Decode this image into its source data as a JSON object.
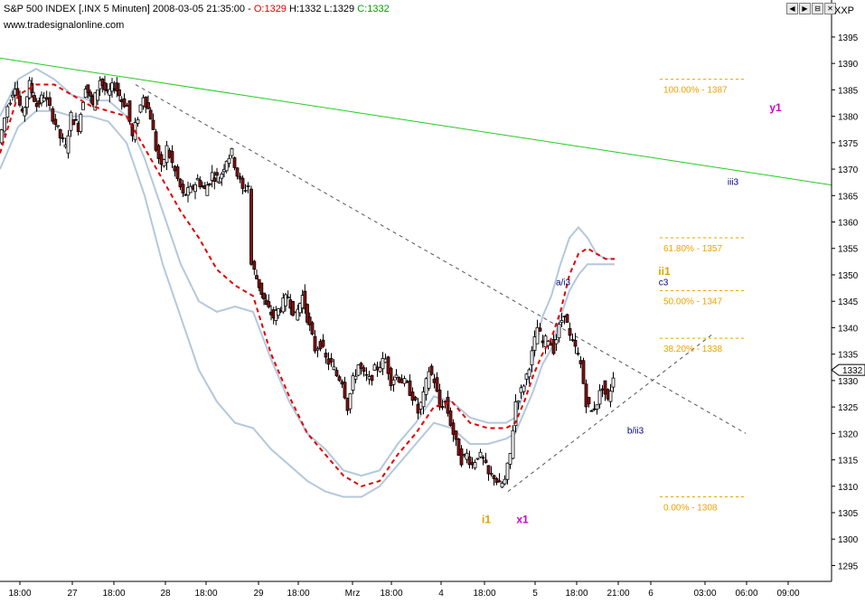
{
  "header": {
    "symbol_text": "S&P 500 INDEX [.INX  5 Minuten]",
    "datetime": "2008-03-05 21:35:00",
    "open_label": "O:1329",
    "hlc_label": "H:1332 L:1329",
    "close_label": "C:1332",
    "source": "www.tradesignalonline.com",
    "corner_label": "XXP",
    "window_buttons": [
      "◀",
      "▶",
      "⊟",
      "✕"
    ]
  },
  "colors": {
    "trendline_green": "#22cc22",
    "ma_red": "#e00000",
    "band_blue": "#b4c8dc",
    "fib_orange": "#f0a000",
    "wave_magenta": "#cc00cc",
    "wave_navy": "#000080",
    "wave_orange": "#e0a000",
    "candle_up": "#ffffff",
    "candle_down": "#8b1010"
  },
  "chart_data": {
    "type": "candlestick",
    "title": "S&P 500 INDEX [.INX  5 Minuten]",
    "ylim": [
      1292,
      1402
    ],
    "y_ticks": [
      1295,
      1300,
      1305,
      1310,
      1315,
      1320,
      1325,
      1330,
      1335,
      1340,
      1345,
      1350,
      1355,
      1360,
      1365,
      1370,
      1375,
      1380,
      1385,
      1390,
      1395
    ],
    "x_ticks": [
      "18:00",
      "27",
      "18:00",
      "28",
      "18:00",
      "29",
      "18:00",
      "Mrz",
      "18:00",
      "4",
      "18:00",
      "5",
      "18:00",
      "21:00",
      "6",
      "03:00",
      "06:00",
      "09:00"
    ],
    "last_price_label": "1332",
    "price_path": [
      [
        0,
        1375
      ],
      [
        10,
        1382
      ],
      [
        18,
        1386
      ],
      [
        26,
        1380
      ],
      [
        34,
        1386
      ],
      [
        42,
        1382
      ],
      [
        50,
        1384
      ],
      [
        60,
        1380
      ],
      [
        68,
        1376
      ],
      [
        74,
        1374
      ],
      [
        80,
        1380
      ],
      [
        88,
        1378
      ],
      [
        96,
        1386
      ],
      [
        104,
        1382
      ],
      [
        112,
        1387
      ],
      [
        120,
        1384
      ],
      [
        128,
        1386
      ],
      [
        136,
        1383
      ],
      [
        142,
        1382
      ],
      [
        148,
        1376
      ],
      [
        154,
        1380
      ],
      [
        160,
        1384
      ],
      [
        168,
        1380
      ],
      [
        174,
        1374
      ],
      [
        180,
        1370
      ],
      [
        186,
        1374
      ],
      [
        192,
        1371
      ],
      [
        198,
        1368
      ],
      [
        204,
        1365
      ],
      [
        212,
        1366
      ],
      [
        220,
        1368
      ],
      [
        228,
        1366
      ],
      [
        236,
        1369
      ],
      [
        244,
        1368
      ],
      [
        252,
        1372
      ],
      [
        258,
        1373
      ],
      [
        264,
        1369
      ],
      [
        270,
        1366
      ],
      [
        276,
        1367
      ],
      [
        280,
        1352
      ],
      [
        288,
        1348
      ],
      [
        296,
        1344
      ],
      [
        304,
        1342
      ],
      [
        312,
        1344
      ],
      [
        320,
        1346
      ],
      [
        328,
        1342
      ],
      [
        336,
        1346
      ],
      [
        344,
        1340
      ],
      [
        350,
        1336
      ],
      [
        356,
        1337
      ],
      [
        362,
        1334
      ],
      [
        368,
        1333
      ],
      [
        374,
        1331
      ],
      [
        380,
        1330
      ],
      [
        386,
        1325
      ],
      [
        392,
        1330
      ],
      [
        398,
        1333
      ],
      [
        404,
        1331
      ],
      [
        410,
        1330
      ],
      [
        416,
        1332
      ],
      [
        422,
        1333
      ],
      [
        428,
        1334
      ],
      [
        434,
        1330
      ],
      [
        440,
        1331
      ],
      [
        446,
        1330
      ],
      [
        452,
        1329
      ],
      [
        458,
        1327
      ],
      [
        464,
        1324
      ],
      [
        470,
        1327
      ],
      [
        476,
        1332
      ],
      [
        482,
        1330
      ],
      [
        488,
        1325
      ],
      [
        494,
        1326
      ],
      [
        500,
        1322
      ],
      [
        506,
        1318
      ],
      [
        512,
        1315
      ],
      [
        518,
        1316
      ],
      [
        524,
        1314
      ],
      [
        530,
        1316
      ],
      [
        536,
        1315
      ],
      [
        542,
        1312
      ],
      [
        548,
        1312
      ],
      [
        554,
        1310
      ],
      [
        560,
        1311
      ],
      [
        566,
        1316
      ],
      [
        572,
        1326
      ],
      [
        578,
        1328
      ],
      [
        584,
        1331
      ],
      [
        590,
        1335
      ],
      [
        596,
        1340
      ],
      [
        602,
        1337
      ],
      [
        608,
        1338
      ],
      [
        614,
        1336
      ],
      [
        620,
        1340
      ],
      [
        626,
        1343
      ],
      [
        632,
        1338
      ],
      [
        638,
        1336
      ],
      [
        644,
        1333
      ],
      [
        650,
        1326
      ],
      [
        656,
        1324
      ],
      [
        662,
        1326
      ],
      [
        668,
        1329
      ],
      [
        674,
        1326
      ],
      [
        680,
        1331
      ]
    ],
    "ma_path": [
      [
        0,
        1373
      ],
      [
        20,
        1384
      ],
      [
        40,
        1386
      ],
      [
        60,
        1386
      ],
      [
        80,
        1384
      ],
      [
        100,
        1382
      ],
      [
        120,
        1381
      ],
      [
        140,
        1380
      ],
      [
        160,
        1374
      ],
      [
        180,
        1368
      ],
      [
        200,
        1362
      ],
      [
        220,
        1357
      ],
      [
        240,
        1351
      ],
      [
        260,
        1348
      ],
      [
        280,
        1346
      ],
      [
        300,
        1335
      ],
      [
        320,
        1327
      ],
      [
        340,
        1320
      ],
      [
        360,
        1316
      ],
      [
        380,
        1312
      ],
      [
        400,
        1310
      ],
      [
        420,
        1311
      ],
      [
        440,
        1316
      ],
      [
        460,
        1320
      ],
      [
        480,
        1325
      ],
      [
        500,
        1326
      ],
      [
        520,
        1322
      ],
      [
        540,
        1321
      ],
      [
        560,
        1321
      ],
      [
        570,
        1322
      ],
      [
        580,
        1326
      ],
      [
        590,
        1331
      ],
      [
        600,
        1335
      ],
      [
        610,
        1338
      ],
      [
        620,
        1343
      ],
      [
        630,
        1350
      ],
      [
        640,
        1354
      ],
      [
        650,
        1355
      ],
      [
        660,
        1354
      ],
      [
        670,
        1353
      ],
      [
        680,
        1353
      ]
    ],
    "upper_band": [
      [
        0,
        1380
      ],
      [
        20,
        1387
      ],
      [
        40,
        1389
      ],
      [
        60,
        1387
      ],
      [
        80,
        1384
      ],
      [
        100,
        1383
      ],
      [
        120,
        1383
      ],
      [
        140,
        1380
      ],
      [
        160,
        1372
      ],
      [
        180,
        1362
      ],
      [
        200,
        1352
      ],
      [
        220,
        1345
      ],
      [
        240,
        1343
      ],
      [
        260,
        1344
      ],
      [
        280,
        1343
      ],
      [
        300,
        1334
      ],
      [
        320,
        1326
      ],
      [
        340,
        1320
      ],
      [
        360,
        1317
      ],
      [
        380,
        1313
      ],
      [
        400,
        1312
      ],
      [
        420,
        1313
      ],
      [
        440,
        1318
      ],
      [
        460,
        1322
      ],
      [
        480,
        1327
      ],
      [
        500,
        1326
      ],
      [
        520,
        1323
      ],
      [
        540,
        1322
      ],
      [
        560,
        1322
      ],
      [
        570,
        1323
      ],
      [
        580,
        1328
      ],
      [
        590,
        1334
      ],
      [
        600,
        1342
      ],
      [
        610,
        1346
      ],
      [
        620,
        1352
      ],
      [
        630,
        1357
      ],
      [
        640,
        1359
      ],
      [
        650,
        1357
      ],
      [
        660,
        1354
      ],
      [
        670,
        1353
      ],
      [
        680,
        1353
      ]
    ],
    "lower_band": [
      [
        0,
        1370
      ],
      [
        20,
        1378
      ],
      [
        40,
        1381
      ],
      [
        60,
        1381
      ],
      [
        80,
        1380
      ],
      [
        100,
        1380
      ],
      [
        120,
        1379
      ],
      [
        140,
        1375
      ],
      [
        160,
        1365
      ],
      [
        180,
        1352
      ],
      [
        200,
        1342
      ],
      [
        220,
        1332
      ],
      [
        240,
        1326
      ],
      [
        260,
        1322
      ],
      [
        280,
        1321
      ],
      [
        300,
        1317
      ],
      [
        320,
        1314
      ],
      [
        340,
        1311
      ],
      [
        360,
        1309
      ],
      [
        380,
        1308
      ],
      [
        400,
        1308
      ],
      [
        420,
        1310
      ],
      [
        440,
        1314
      ],
      [
        460,
        1318
      ],
      [
        480,
        1322
      ],
      [
        500,
        1321
      ],
      [
        520,
        1318
      ],
      [
        540,
        1318
      ],
      [
        560,
        1319
      ],
      [
        570,
        1320
      ],
      [
        580,
        1324
      ],
      [
        590,
        1328
      ],
      [
        600,
        1333
      ],
      [
        610,
        1336
      ],
      [
        620,
        1342
      ],
      [
        630,
        1347
      ],
      [
        640,
        1350
      ],
      [
        650,
        1352
      ],
      [
        660,
        1352
      ],
      [
        670,
        1352
      ],
      [
        680,
        1352
      ]
    ],
    "trendlines": [
      {
        "style": "solid",
        "color": "trendline_green",
        "from": [
          0,
          1391
        ],
        "to": [
          920,
          1367
        ]
      },
      {
        "style": "dashed",
        "color": "gray",
        "from": [
          150,
          1386
        ],
        "to": [
          825,
          1320
        ]
      },
      {
        "style": "dashed",
        "color": "gray",
        "from": [
          562,
          1309
        ],
        "to": [
          790,
          1339
        ]
      }
    ],
    "fib_levels": [
      {
        "label": "100.00% - 1387",
        "value": 1387
      },
      {
        "label": "61.80% - 1357",
        "value": 1357
      },
      {
        "label": "50.00% - 1347",
        "value": 1347
      },
      {
        "label": "38.20% - 1338",
        "value": 1338
      },
      {
        "label": "0.00% - 1308",
        "value": 1308
      }
    ],
    "wave_labels": [
      {
        "text": "y1",
        "color": "wave_magenta",
        "x": 858,
        "y": 1381
      },
      {
        "text": "iii3",
        "color": "wave_navy",
        "x": 811,
        "y": 1367
      },
      {
        "text": "ii1",
        "color": "wave_orange",
        "x": 735,
        "y": 1350
      },
      {
        "text": "c3",
        "color": "wave_navy",
        "x": 734,
        "y": 1348
      },
      {
        "text": "a/i3",
        "color": "wave_navy",
        "x": 623,
        "y": 1348
      },
      {
        "text": "b/ii3",
        "color": "wave_navy",
        "x": 703,
        "y": 1320
      },
      {
        "text": "i1",
        "color": "wave_orange",
        "x": 538,
        "y": 1303
      },
      {
        "text": "x1",
        "color": "wave_magenta",
        "x": 578,
        "y": 1303
      }
    ]
  }
}
